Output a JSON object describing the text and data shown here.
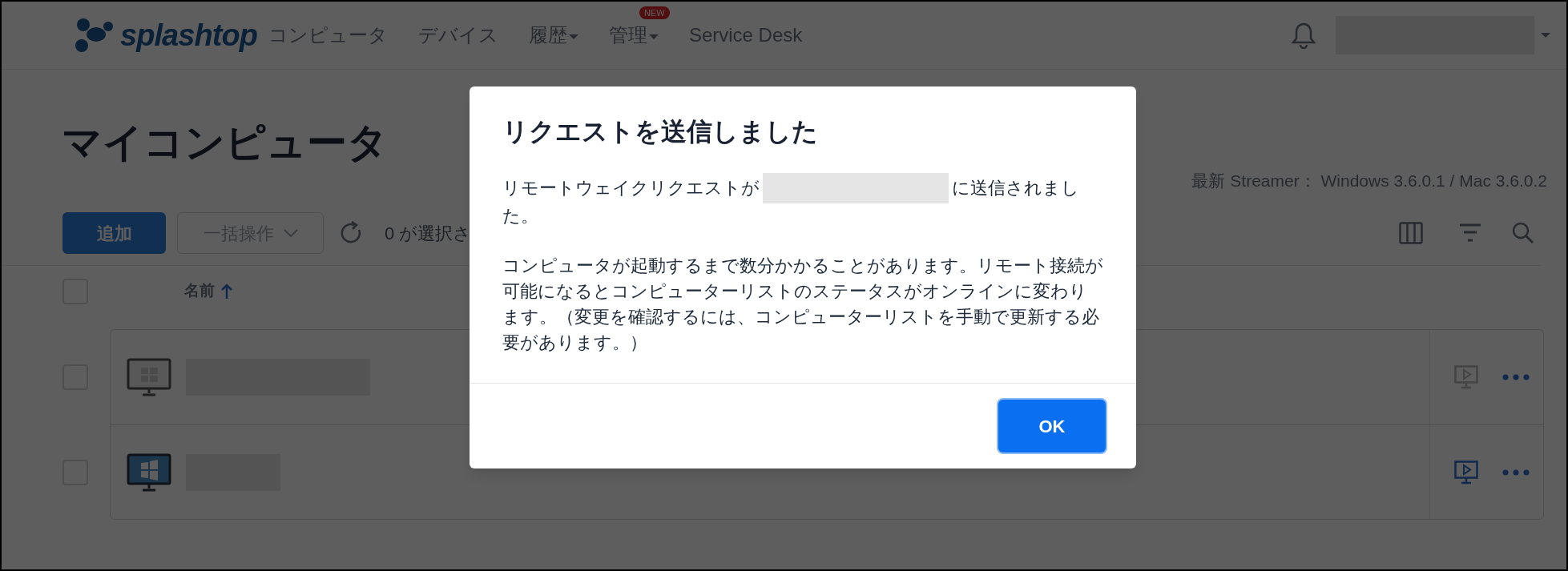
{
  "header": {
    "logo_text": "splashtop",
    "nav": [
      {
        "label": "コンピュータ",
        "dropdown": false
      },
      {
        "label": "デバイス",
        "dropdown": false
      },
      {
        "label": "履歴",
        "dropdown": true
      },
      {
        "label": "管理",
        "dropdown": true,
        "badge": "NEW"
      },
      {
        "label": "Service Desk",
        "dropdown": false
      }
    ]
  },
  "page_title": "マイコンピュータ",
  "streamer_info": "最新 Streamer： Windows 3.6.0.1 / Mac 3.6.0.2",
  "toolbar": {
    "add_button": "追加",
    "bulk_button": "一括操作",
    "selection_count": "0 が選択さ"
  },
  "table": {
    "select_all_checked": false,
    "columns": [
      {
        "label": "名前",
        "sort_ascending": true
      }
    ],
    "rows": [
      {
        "checked": false,
        "online": false
      },
      {
        "checked": false,
        "online": true
      }
    ]
  },
  "dialog": {
    "title": "リクエストを送信しました",
    "message_before": "リモートウェイクリクエストが",
    "message_after": "に送信されまし",
    "message_continued": "た。",
    "note": "コンピュータが起動するまで数分かかることがあります。リモート接続が可能になるとコンピューターリストのステータスがオンラインに変わります。（変更を確認するには、コンピューターリストを手動で更新する必要があります。）",
    "ok_button": "OK"
  }
}
